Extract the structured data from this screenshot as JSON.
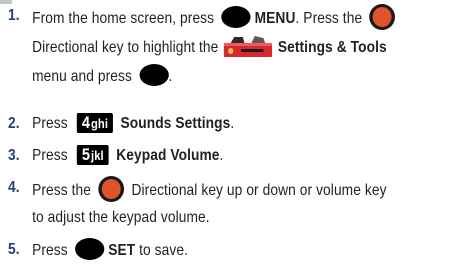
{
  "steps": [
    {
      "number": "1.",
      "line1_a": "From the home screen, press",
      "line1_b": "MENU",
      "line1_c": ". Press the",
      "line2_a": "Directional key to highlight the",
      "line2_b": "Settings & Tools",
      "line3_a": "menu and press",
      "line3_b": "."
    },
    {
      "number": "2.",
      "lead": "Press",
      "key_big": "4",
      "key_small": "ghi",
      "label": "Sounds Settings",
      "trail": "."
    },
    {
      "number": "3.",
      "lead": "Press",
      "key_big": "5",
      "key_small": "jkl",
      "label": "Keypad Volume",
      "trail": "."
    },
    {
      "number": "4.",
      "line1_a": "Press the",
      "line1_b": "Directional key up or down or volume key",
      "line2": "to adjust the keypad volume."
    },
    {
      "number": "5.",
      "lead": "Press",
      "label": "SET",
      "trail": "to save."
    }
  ],
  "icons": {
    "menu_key": "black-oval-button-icon",
    "directional_key": "orange-directional-key-icon",
    "settings_tools": "settings-tools-toolbox-icon",
    "ok_key": "black-oval-button-icon",
    "set_key": "black-oval-button-icon"
  },
  "colors": {
    "step_number": "#1e3f80",
    "text": "#231f20",
    "directional_key": "#e0542b",
    "key_bg": "#000000"
  }
}
